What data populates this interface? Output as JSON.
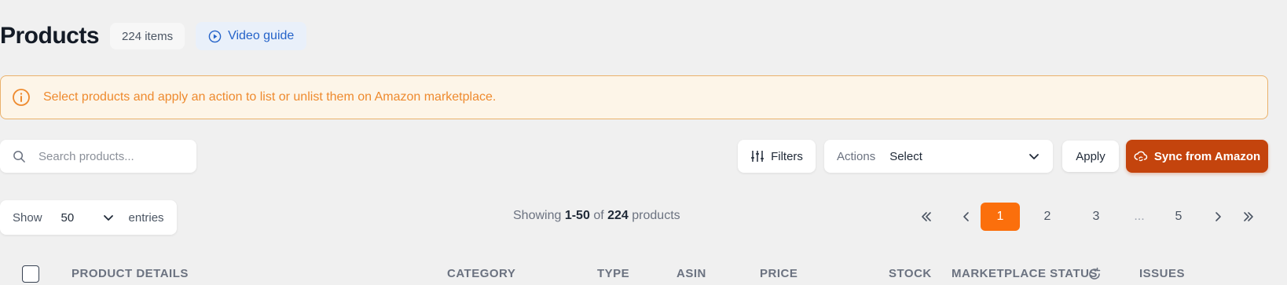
{
  "header": {
    "title": "Products",
    "item_count": "224 items",
    "video_guide_label": "Video guide"
  },
  "alert": {
    "message": "Select products and apply an action to list or unlist them on Amazon marketplace."
  },
  "toolbar": {
    "search_placeholder": "Search products...",
    "filters_label": "Filters",
    "actions_label": "Actions",
    "actions_value": "Select",
    "apply_label": "Apply",
    "sync_label": "Sync from Amazon"
  },
  "entries": {
    "show_label": "Show",
    "value": "50",
    "entries_label": "entries"
  },
  "summary": {
    "prefix": "Showing",
    "range": "1-50",
    "of": "of",
    "total": "224",
    "suffix": "products"
  },
  "pagination": {
    "pages": [
      "1",
      "2",
      "3",
      "...",
      "5"
    ],
    "current": "1"
  },
  "table": {
    "columns": [
      "PRODUCT DETAILS",
      "CATEGORY",
      "TYPE",
      "ASIN",
      "PRICE",
      "STOCK",
      "MARKETPLACE STATUS",
      "ISSUES"
    ]
  },
  "colors": {
    "accent": "#fb6f0c",
    "sync_button": "#c4440d",
    "alert_text": "#ee8a2e",
    "alert_border": "#eab16b",
    "link_blue": "#2563c9"
  },
  "icons": [
    "play-circle-icon",
    "info-icon",
    "search-icon",
    "sliders-icon",
    "chevron-down-icon",
    "sync-cloud-icon",
    "chevrons-left-icon",
    "chevron-left-icon",
    "chevron-right-icon",
    "chevrons-right-icon",
    "refresh-icon"
  ]
}
